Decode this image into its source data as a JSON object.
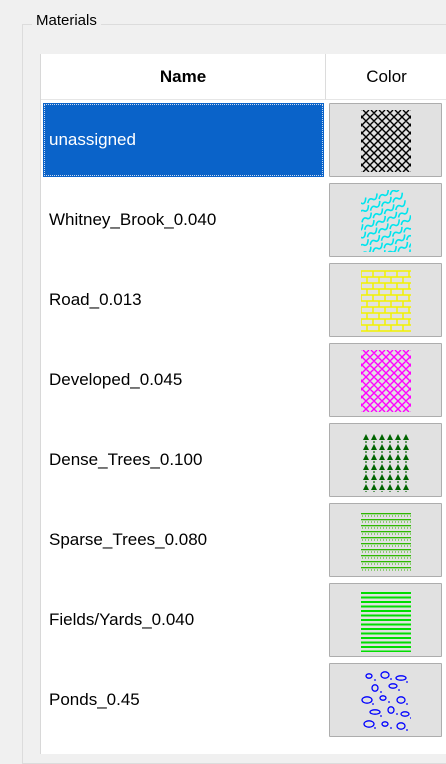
{
  "group": {
    "title": "Materials"
  },
  "table": {
    "headers": {
      "name": "Name",
      "color": "Color"
    },
    "rows": [
      {
        "name": "unassigned",
        "pattern": "crosshatch-diamond",
        "color": "#000000",
        "selected": true
      },
      {
        "name": "Whitney_Brook_0.040",
        "pattern": "water-waves",
        "color": "#00e5ee",
        "selected": false
      },
      {
        "name": "Road_0.013",
        "pattern": "brick",
        "color": "#f2f200",
        "selected": false
      },
      {
        "name": "Developed_0.045",
        "pattern": "crosshatch-diamond",
        "color": "#ff00ff",
        "selected": false
      },
      {
        "name": "Dense_Trees_0.100",
        "pattern": "dense-trees",
        "color": "#006400",
        "selected": false
      },
      {
        "name": "Sparse_Trees_0.080",
        "pattern": "sparse-trees",
        "color": "#2eb800",
        "selected": false
      },
      {
        "name": "Fields/Yards_0.040",
        "pattern": "horizontal-lines",
        "color": "#00dd00",
        "selected": false
      },
      {
        "name": "Ponds_0.45",
        "pattern": "pebbles",
        "color": "#0000ff",
        "selected": false
      }
    ]
  }
}
